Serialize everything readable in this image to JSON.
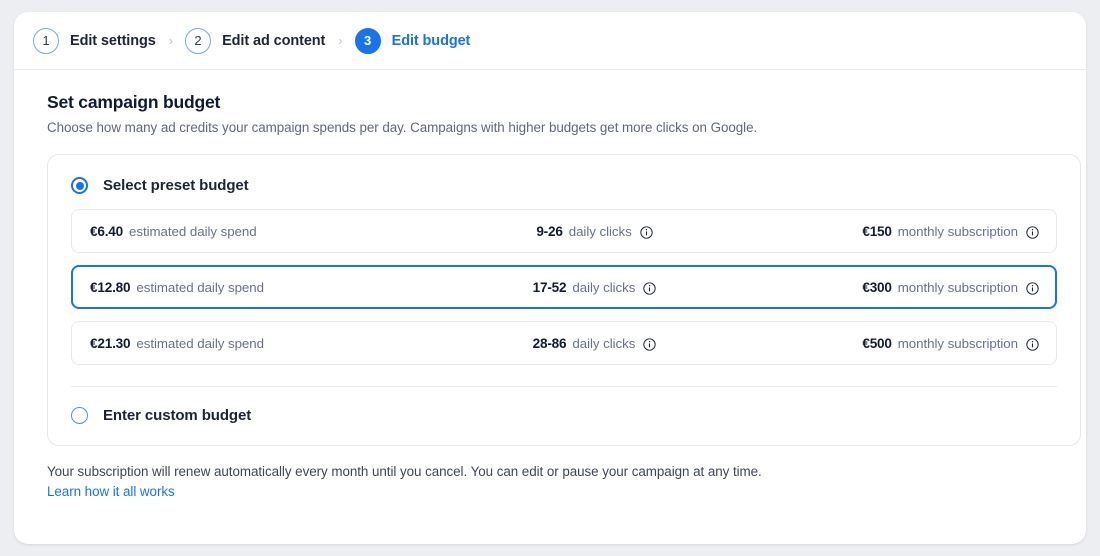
{
  "stepper": {
    "separator": "›",
    "steps": [
      {
        "number": "1",
        "label": "Edit settings",
        "state": "todo"
      },
      {
        "number": "2",
        "label": "Edit ad content",
        "state": "todo"
      },
      {
        "number": "3",
        "label": "Edit budget",
        "state": "active"
      }
    ]
  },
  "main": {
    "title": "Set campaign budget",
    "subtitle": "Choose how many ad credits your campaign spends per day. Campaigns with higher budgets get more clicks on Google."
  },
  "options": {
    "preset": {
      "label": "Select preset budget",
      "selected": true
    },
    "custom": {
      "label": "Enter custom budget",
      "selected": false
    },
    "info_icon": "info-icon",
    "rows": [
      {
        "daily_spend_value": "€6.40",
        "daily_spend_unit": "estimated daily spend",
        "clicks_value": "9-26",
        "clicks_unit": "daily clicks",
        "subscription_value": "€150",
        "subscription_unit": "monthly subscription",
        "selected": false
      },
      {
        "daily_spend_value": "€12.80",
        "daily_spend_unit": "estimated daily spend",
        "clicks_value": "17-52",
        "clicks_unit": "daily clicks",
        "subscription_value": "€300",
        "subscription_unit": "monthly subscription",
        "selected": true
      },
      {
        "daily_spend_value": "€21.30",
        "daily_spend_unit": "estimated daily spend",
        "clicks_value": "28-86",
        "clicks_unit": "daily clicks",
        "subscription_value": "€500",
        "subscription_unit": "monthly subscription",
        "selected": false
      }
    ]
  },
  "footer": {
    "note": "Your subscription will renew automatically every month until you cancel. You can edit or pause your campaign at any time.",
    "link": "Learn how it all works"
  },
  "colors": {
    "accent": "#1a73e8",
    "page_background": "#eceef2",
    "card_background": "#ffffff",
    "border": "#e4e9f1",
    "text_primary": "#131b2e",
    "text_muted": "#69718a"
  }
}
